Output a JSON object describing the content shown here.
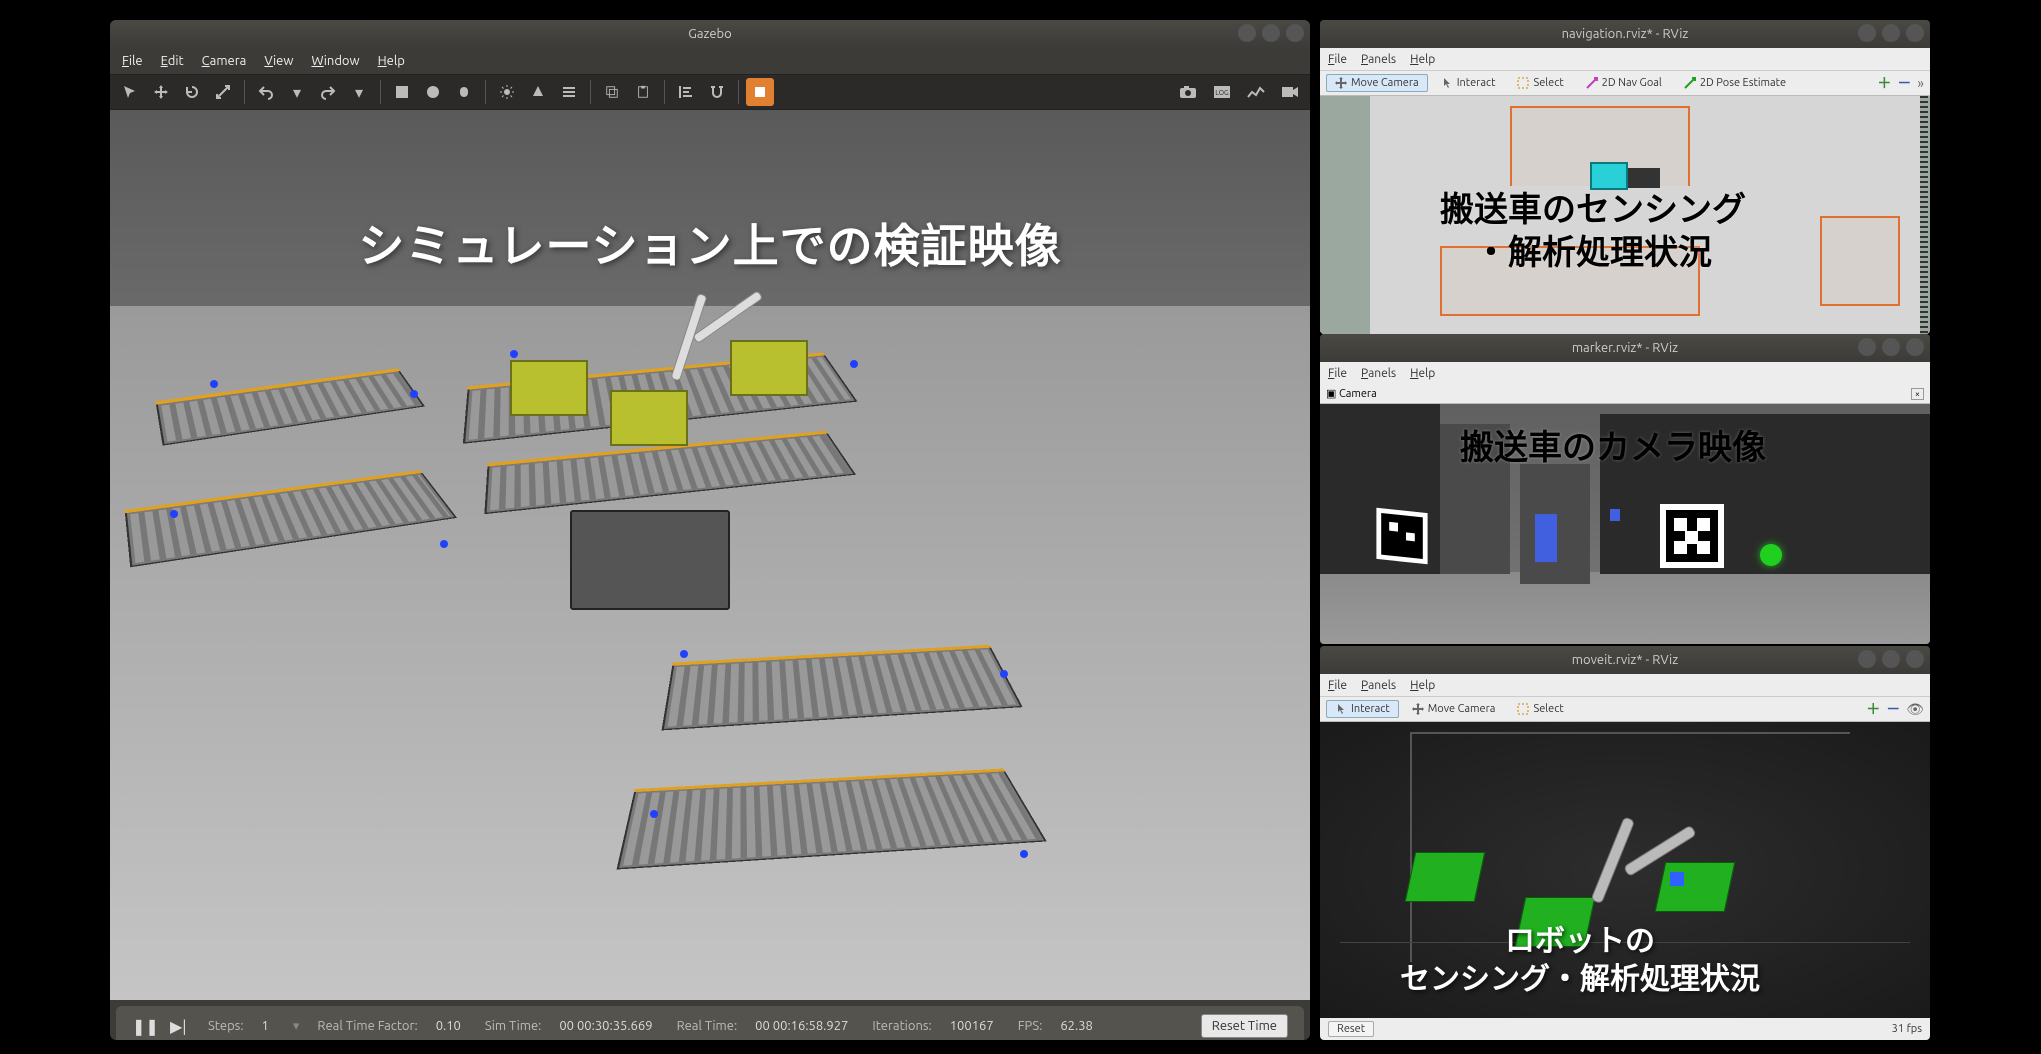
{
  "gazebo": {
    "title": "Gazebo",
    "menu": {
      "file": "File",
      "edit": "Edit",
      "camera": "Camera",
      "view": "View",
      "window": "Window",
      "help": "Help"
    },
    "overlay": "シミュレーション上での検証映像",
    "status": {
      "steps_label": "Steps:",
      "steps": "1",
      "rtf_label": "Real Time Factor:",
      "rtf": "0.10",
      "simtime_label": "Sim Time:",
      "simtime": "00 00:30:35.669",
      "realtime_label": "Real Time:",
      "realtime": "00 00:16:58.927",
      "iter_label": "Iterations:",
      "iter": "100167",
      "fps_label": "FPS:",
      "fps": "62.38",
      "reset": "Reset Time"
    }
  },
  "rviz1": {
    "title": "navigation.rviz* - RViz",
    "menu": {
      "file": "File",
      "panels": "Panels",
      "help": "Help"
    },
    "tools": {
      "move_camera": "Move Camera",
      "interact": "Interact",
      "select": "Select",
      "nav_goal": "2D Nav Goal",
      "pose_est": "2D Pose Estimate"
    },
    "overlay": "搬送車のセンシング\n・解析処理状況"
  },
  "rviz2": {
    "title": "marker.rviz* - RViz",
    "menu": {
      "file": "File",
      "panels": "Panels",
      "help": "Help"
    },
    "camera_panel": "Camera",
    "overlay": "搬送車のカメラ映像"
  },
  "rviz3": {
    "title": "moveit.rviz* - RViz",
    "menu": {
      "file": "File",
      "panels": "Panels",
      "help": "Help"
    },
    "tools": {
      "interact": "Interact",
      "move_camera": "Move Camera",
      "select": "Select"
    },
    "overlay": "ロボットの\nセンシング・解析処理状況",
    "status": {
      "reset": "Reset",
      "fps": "31 fps"
    }
  }
}
